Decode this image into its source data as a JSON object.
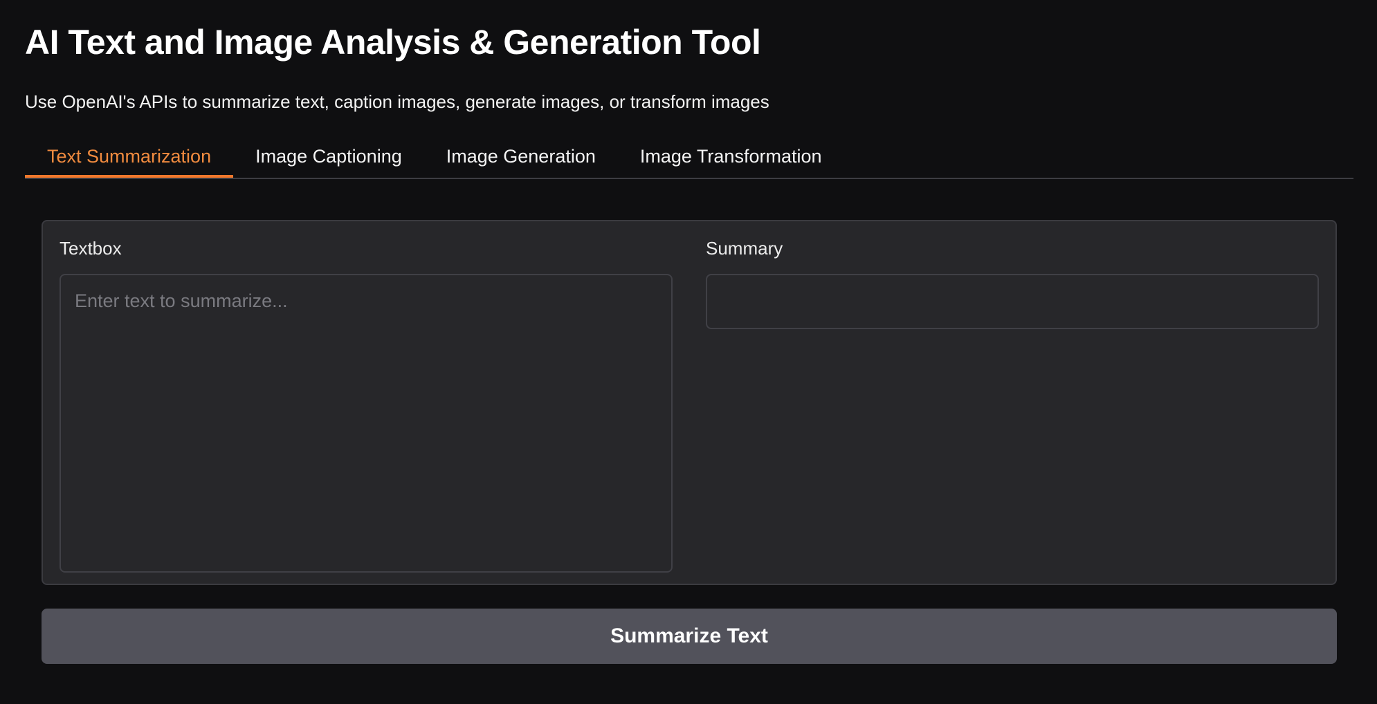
{
  "header": {
    "title": "AI Text and Image Analysis & Generation Tool",
    "subtitle": "Use OpenAI's APIs to summarize text, caption images, generate images, or transform images"
  },
  "tabs": [
    {
      "label": "Text Summarization",
      "active": true
    },
    {
      "label": "Image Captioning",
      "active": false
    },
    {
      "label": "Image Generation",
      "active": false
    },
    {
      "label": "Image Transformation",
      "active": false
    }
  ],
  "main": {
    "input": {
      "label": "Textbox",
      "placeholder": "Enter text to summarize...",
      "value": ""
    },
    "output": {
      "label": "Summary",
      "value": ""
    },
    "submit_label": "Summarize Text"
  },
  "colors": {
    "background": "#0f0f11",
    "panel": "#27272a",
    "accent": "#f0772c",
    "button": "#52525b"
  }
}
